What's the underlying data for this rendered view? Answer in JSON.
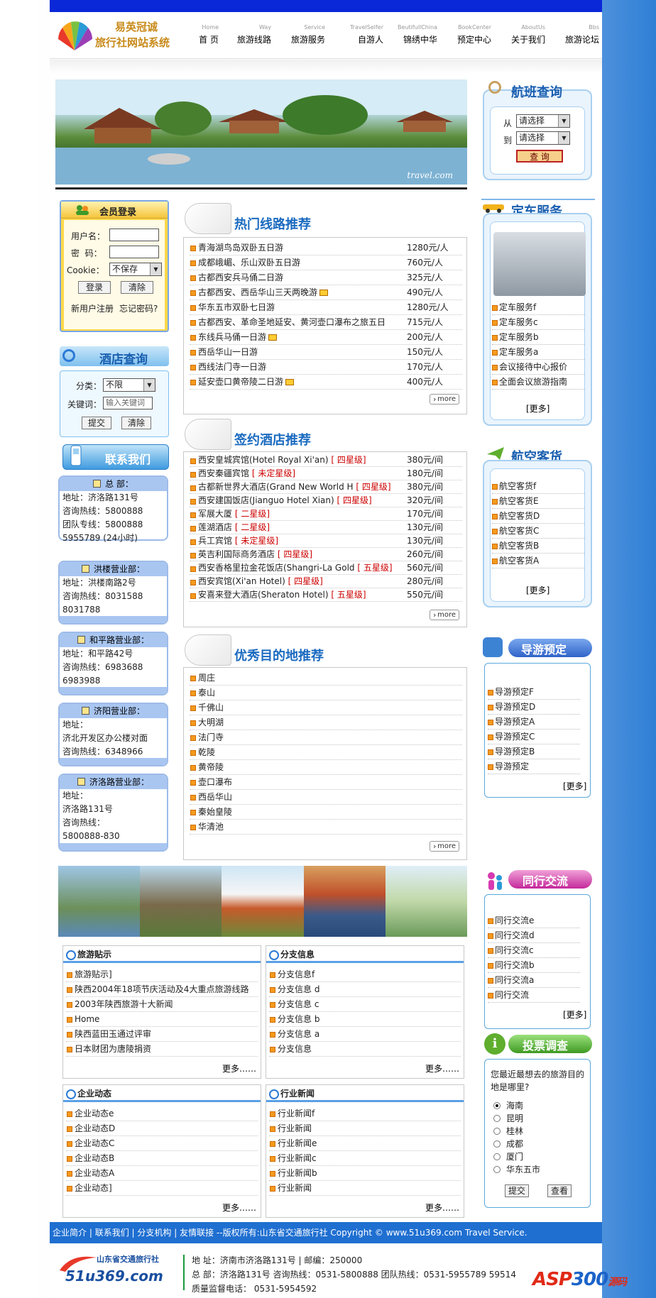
{
  "logo": {
    "line1": "易英冠诚",
    "line2": "旅行社网站系统"
  },
  "nav": [
    {
      "en": "Home",
      "zh": "首 页"
    },
    {
      "en": "Way",
      "zh": "旅游线路"
    },
    {
      "en": "Service",
      "zh": "旅游服务"
    },
    {
      "en": "TravelSelfer",
      "zh": "自游人"
    },
    {
      "en": "BeutifullChina",
      "zh": "锦绣中华"
    },
    {
      "en": "BookCenter",
      "zh": "预定中心"
    },
    {
      "en": "AboutUs",
      "zh": "关于我们"
    },
    {
      "en": "Bbs",
      "zh": "旅游论坛"
    }
  ],
  "banner": {
    "caption": "travel.com"
  },
  "flight": {
    "title": "航班查询",
    "from_label": "从",
    "to_label": "到",
    "from_value": "请选择",
    "to_value": "请选择",
    "button": "查 询"
  },
  "login": {
    "title": "会员登录",
    "user_label": "用户名：",
    "pass_label": "密  码：",
    "cookie_label": "Cookie：",
    "cookie_value": "不保存",
    "login_btn": "登录",
    "clear_btn": "清除",
    "register": "新用户注册",
    "forgot": "忘记密码?"
  },
  "hotel_search": {
    "title": "酒店查询",
    "category_label": "分类：",
    "category_value": "不限",
    "keyword_label": "关键词：",
    "keyword_placeholder": "输入关键词",
    "submit": "提交",
    "clear": "清除"
  },
  "contact": {
    "title": "联系我们",
    "offices": [
      {
        "name": "总  部：",
        "lines": [
          "地址：济洛路131号",
          "咨询热线：5800888",
          "团队专线：5800888",
          "5955789 (24小时)"
        ]
      },
      {
        "name": "洪楼营业部：",
        "lines": [
          "地址：洪楼南路2号",
          "咨询热线：8031588",
          "8031788"
        ]
      },
      {
        "name": "和平路营业部：",
        "lines": [
          "地址：和平路42号",
          "咨询热线：6983688",
          "6983988"
        ]
      },
      {
        "name": "济阳营业部：",
        "lines": [
          "地址：",
          "济北开发区办公楼对面",
          "咨询热线：6348966"
        ]
      },
      {
        "name": "济洛路营业部：",
        "lines": [
          "地址：",
          "济洛路131号",
          "咨询热线：",
          "5800888-830"
        ]
      }
    ]
  },
  "routes": {
    "title": "热门线路推荐",
    "items": [
      {
        "name": "青海湖鸟岛双卧五日游",
        "price": "1280元/人",
        "new": false
      },
      {
        "name": "成都峨嵋、乐山双卧五日游",
        "price": "760元/人",
        "new": false
      },
      {
        "name": "古都西安兵马俑二日游",
        "price": "325元/人",
        "new": false
      },
      {
        "name": "古都西安、西岳华山三天两晚游",
        "price": "490元/人",
        "new": true
      },
      {
        "name": "华东五市双卧七日游",
        "price": "1280元/人",
        "new": false
      },
      {
        "name": "古都西安、革命圣地延安、黄河壶口瀑布之旅五日",
        "price": "715元/人",
        "new": false
      },
      {
        "name": "东线兵马俑一日游",
        "price": "200元/人",
        "new": true
      },
      {
        "name": "西岳华山一日游",
        "price": "150元/人",
        "new": false
      },
      {
        "name": "西线法门寺一日游",
        "price": "170元/人",
        "new": false
      },
      {
        "name": "延安壶口黄帝陵二日游",
        "price": "400元/人",
        "new": true
      }
    ],
    "more": "more"
  },
  "hotels": {
    "title": "签约酒店推荐",
    "items": [
      {
        "name": "西安皇城宾馆(Hotel Royal Xi'an)",
        "star": "[ 四星级]",
        "price": "380元/间"
      },
      {
        "name": "西安秦疆宾馆",
        "star": "[ 未定星级]",
        "price": "180元/间"
      },
      {
        "name": "古都新世界大酒店(Grand New World H",
        "star": "[ 四星级]",
        "price": "380元/间"
      },
      {
        "name": "西安建国饭店(Jianguo Hotel Xian)",
        "star": "[ 四星级]",
        "price": "320元/间"
      },
      {
        "name": "军展大厦",
        "star": "[ 二星级]",
        "price": "170元/间"
      },
      {
        "name": "莲湖酒店",
        "star": "[ 二星级]",
        "price": "130元/间"
      },
      {
        "name": "兵工宾馆",
        "star": "[ 未定星级]",
        "price": "130元/间"
      },
      {
        "name": "英吉利国际商务酒店",
        "star": "[ 四星级]",
        "price": "260元/间"
      },
      {
        "name": "西安香格里拉金花饭店(Shangri-La Gold",
        "star": "[ 五星级]",
        "price": "560元/间"
      },
      {
        "name": "西安宾馆(Xi'an Hotel)",
        "star": "[ 四星级]",
        "price": "280元/间"
      },
      {
        "name": "安喜来登大酒店(Sheraton Hotel)",
        "star": "[ 五星级]",
        "price": "550元/间"
      }
    ],
    "more": "more"
  },
  "destinations": {
    "title": "优秀目的地推荐",
    "items": [
      "周庄",
      "泰山",
      "千佛山",
      "大明湖",
      "法门寺",
      "乾陵",
      "黄帝陵",
      "壶口瀑布",
      "西岳华山",
      "秦始皇陵",
      "华清池"
    ],
    "more": "more"
  },
  "car": {
    "title": "定车服务",
    "items": [
      "定车服务f",
      "定车服务c",
      "定车服务b",
      "定车服务a",
      "会议接待中心报价",
      "全面会议旅游指南"
    ],
    "more": "[更多]"
  },
  "cargo": {
    "title": "航空客货",
    "items": [
      "航空客货f",
      "航空客货E",
      "航空客货D",
      "航空客货C",
      "航空客货B",
      "航空客货A"
    ],
    "more": "[更多]"
  },
  "guide": {
    "title": "导游预定",
    "items": [
      "导游预定F",
      "导游预定D",
      "导游预定A",
      "导游预定C",
      "导游预定B",
      "导游预定"
    ],
    "more": "[更多]"
  },
  "exchange": {
    "title": "同行交流",
    "items": [
      "同行交流e",
      "同行交流d",
      "同行交流c",
      "同行交流b",
      "同行交流a",
      "同行交流"
    ],
    "more": "[更多]"
  },
  "vote": {
    "title": "投票调查",
    "question": "您最近最想去的旅游目的地是哪里?",
    "options": [
      "海南",
      "昆明",
      "桂林",
      "成都",
      "厦门",
      "华东五市"
    ],
    "selected": 0,
    "submit": "提交",
    "view": "查看"
  },
  "news": [
    {
      "title": "旅游贴示",
      "items": [
        "旅游贴示]",
        "陕西2004年18项节庆活动及4大重点旅游线路",
        "2003年陕西旅游十大新闻",
        "Home",
        "陕西蓝田玉通过评审",
        "日本财团为唐陵捐资"
      ],
      "more": "更多……"
    },
    {
      "title": "分支信息",
      "items": [
        "分支信息f",
        "分支信息 d",
        "分支信息 c",
        "分支信息 b",
        "分支信息 a",
        "分支信息"
      ],
      "more": "更多……"
    },
    {
      "title": "企业动态",
      "items": [
        "企业动态e",
        "企业动态D",
        "企业动态C",
        "企业动态B",
        "企业动态A",
        "企业动态]"
      ],
      "more": "更多……"
    },
    {
      "title": "行业新闻",
      "items": [
        "行业新闻f",
        "行业新闻",
        "行业新闻e",
        "行业新闻c",
        "行业新闻b",
        "行业新闻"
      ],
      "more": "更多……"
    }
  ],
  "footer": {
    "links": [
      "企业简介",
      "联系我们",
      "分支机构",
      "友情联接"
    ],
    "copyright": "--版权所有:山东省交通旅行社  Copyright © www.51u369.com Travel Service.",
    "company": "山东省交通旅行社",
    "site": "51u369.com",
    "line1": "地  址：济南市济洛路131号 | 邮编：250000",
    "line2": "总  部：济洛路131号 咨询热线：0531-5800888 团队热线：0531-5955789 59514",
    "line3": "质量监督电话：  0531-5954592",
    "watermark1": "ASP",
    "watermark2": "300",
    "watermark3": "源码"
  },
  "colors": {
    "accent": "#1a6ac0",
    "topbar": "#0a28d8",
    "footbar": "#1f6fd1",
    "bullet": "#f49a1d"
  }
}
